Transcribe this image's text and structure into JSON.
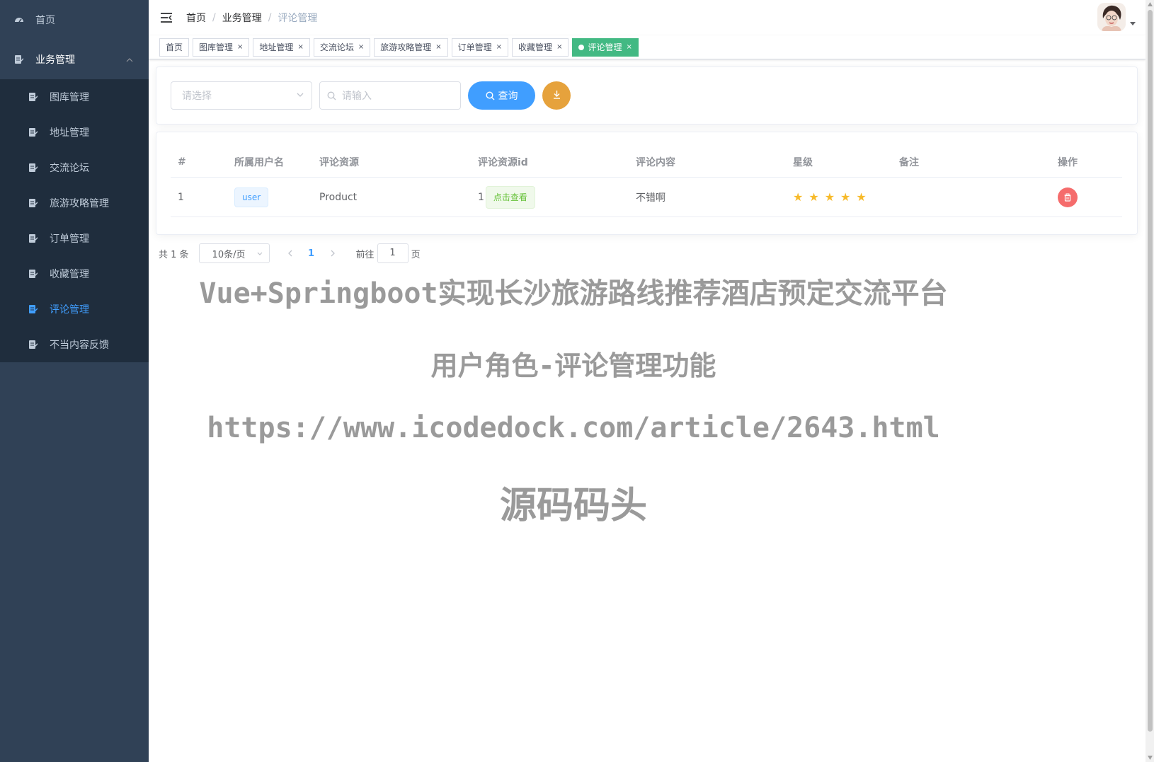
{
  "sidebar": {
    "home": "首页",
    "business": "业务管理",
    "items": [
      {
        "label": "图库管理",
        "active": false
      },
      {
        "label": "地址管理",
        "active": false
      },
      {
        "label": "交流论坛",
        "active": false
      },
      {
        "label": "旅游攻略管理",
        "active": false
      },
      {
        "label": "订单管理",
        "active": false
      },
      {
        "label": "收藏管理",
        "active": false
      },
      {
        "label": "评论管理",
        "active": true
      },
      {
        "label": "不当内容反馈",
        "active": false
      }
    ]
  },
  "breadcrumb": [
    "首页",
    "业务管理",
    "评论管理"
  ],
  "tags": [
    {
      "label": "首页",
      "closable": false
    },
    {
      "label": "图库管理",
      "closable": true
    },
    {
      "label": "地址管理",
      "closable": true
    },
    {
      "label": "交流论坛",
      "closable": true
    },
    {
      "label": "旅游攻略管理",
      "closable": true
    },
    {
      "label": "订单管理",
      "closable": true
    },
    {
      "label": "收藏管理",
      "closable": true
    },
    {
      "label": "评论管理",
      "closable": true,
      "active": true
    }
  ],
  "tag_close": "×",
  "search": {
    "select_placeholder": "请选择",
    "input_placeholder": "请输入",
    "search_button": "查询"
  },
  "table": {
    "headers": [
      "#",
      "所属用户名",
      "评论资源",
      "评论资源id",
      "评论内容",
      "星级",
      "备注",
      "操作"
    ],
    "rows": [
      {
        "index": "1",
        "user": "user",
        "resource": "Product",
        "resource_id": "1",
        "view": "点击查看",
        "content": "不错啊",
        "stars": 5,
        "remark": ""
      }
    ]
  },
  "pagination": {
    "total": "共 1 条",
    "page_size": "10条/页",
    "current": "1",
    "goto_prefix": "前往",
    "goto_value": "1",
    "goto_suffix": "页"
  },
  "watermark": {
    "line1": "Vue+Springboot实现长沙旅游路线推荐酒店预定交流平台",
    "line2": "用户角色-评论管理功能",
    "line3": "https://www.icodedock.com/article/2643.html",
    "line4": "源码码头"
  },
  "colors": {
    "sidebar_bg": "#304156",
    "submenu_bg": "#1f2d3d",
    "primary": "#409eff",
    "tag_active": "#42b983",
    "warning": "#e6a23c",
    "danger": "#f56c6c",
    "star": "#f7ba2a"
  }
}
